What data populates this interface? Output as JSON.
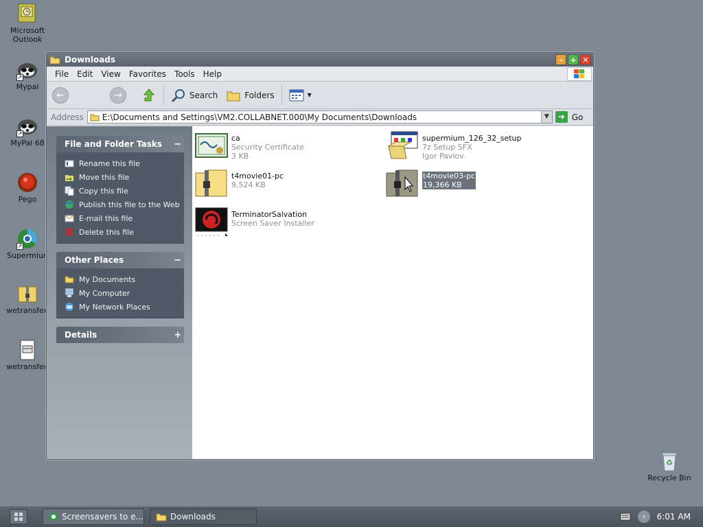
{
  "desktop": {
    "icons": [
      {
        "label_lines": [
          "Microsoft",
          "Outlook"
        ],
        "icon": "outlook-icon"
      },
      {
        "label_lines": [
          "Mypal"
        ],
        "icon": "mypal-icon"
      },
      {
        "label_lines": [
          "MyPal 68"
        ],
        "icon": "mypal68-icon"
      },
      {
        "label_lines": [
          "Pego"
        ],
        "icon": "pego-icon"
      },
      {
        "label_lines": [
          "Supermiun"
        ],
        "icon": "supermium-icon"
      },
      {
        "label_lines": [
          "wetransfer."
        ],
        "icon": "zip-folder-icon"
      },
      {
        "label_lines": [
          "wetransfer."
        ],
        "icon": "document-icon"
      },
      {
        "label_lines": [
          "Recycle Bin"
        ],
        "icon": "recycle-bin-icon"
      }
    ]
  },
  "window": {
    "title": "Downloads",
    "menu": [
      "File",
      "Edit",
      "View",
      "Favorites",
      "Tools",
      "Help"
    ],
    "toolbar": {
      "search": "Search",
      "folders": "Folders"
    },
    "address": {
      "label": "Address",
      "path": "E:\\Documents and Settings\\VM2.COLLABNET.000\\My Documents\\Downloads",
      "go": "Go"
    },
    "sidebar": {
      "file_tasks": {
        "title": "File and Folder Tasks",
        "toggle": "−",
        "items": [
          "Rename this file",
          "Move this file",
          "Copy this file",
          "Publish this file to the Web",
          "E-mail this file",
          "Delete this file"
        ]
      },
      "other_places": {
        "title": "Other Places",
        "toggle": "−",
        "items": [
          "My Documents",
          "My Computer",
          "My Network Places"
        ]
      },
      "details": {
        "title": "Details",
        "toggle": "+"
      }
    },
    "files": [
      {
        "name": "ca",
        "line2": "Security Certificate",
        "line3": "3 KB"
      },
      {
        "name": "supermium_126_32_setup",
        "line2": "7z Setup SFX",
        "line3": "Igor Pavlov"
      },
      {
        "name": "t4movie01-pc",
        "line2": "9,524 KB",
        "line3": ""
      },
      {
        "name": "t4movie03-pc",
        "line2": "19,366 KB",
        "line3": "",
        "selected": true
      },
      {
        "name": "TerminatorSalvation",
        "line2": "Screen Saver Installer",
        "line3": ""
      }
    ]
  },
  "taskbar": {
    "buttons": [
      {
        "label": "Screensavers to e..."
      },
      {
        "label": "Downloads",
        "active": true
      }
    ],
    "clock": "6:01 AM"
  }
}
